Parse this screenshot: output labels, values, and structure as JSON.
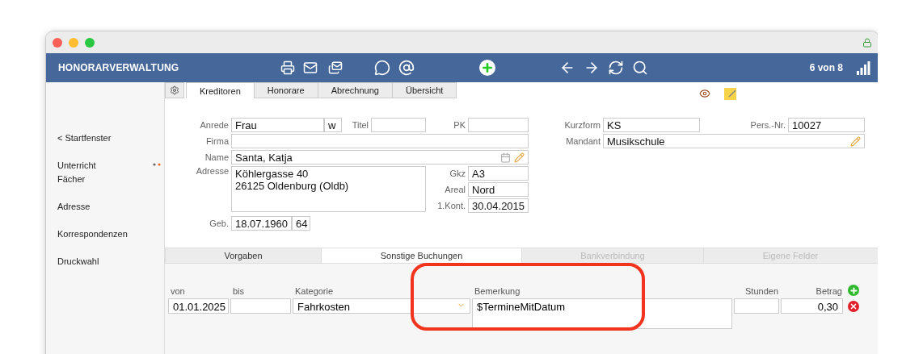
{
  "header": {
    "title": "HONORARVERWALTUNG",
    "counter": "6 von 8"
  },
  "sidebar": {
    "items": [
      {
        "label": "< Startfenster",
        "dots": false
      },
      {
        "label": "Unterricht",
        "dots": true
      },
      {
        "label": "Fächer",
        "dots": false
      },
      {
        "label": "Adresse",
        "dots": false
      },
      {
        "label": "Korrespondenzen",
        "dots": false
      },
      {
        "label": "Druckwahl",
        "dots": false
      }
    ]
  },
  "tabs": [
    {
      "label": "Kreditoren",
      "selected": true
    },
    {
      "label": "Honorare",
      "selected": false
    },
    {
      "label": "Abrechnung",
      "selected": false
    },
    {
      "label": "Übersicht",
      "selected": false
    }
  ],
  "form": {
    "anrede": {
      "label": "Anrede",
      "value": "Frau",
      "gender": "w"
    },
    "titel": {
      "label": "Titel"
    },
    "pk": {
      "label": "PK"
    },
    "firma": {
      "label": "Firma"
    },
    "name": {
      "label": "Name",
      "value": "Santa, Katja"
    },
    "adresse": {
      "label": "Adresse",
      "lines": [
        "Köhlergasse 40",
        "26125 Oldenburg (Oldb)"
      ]
    },
    "gkz": {
      "label": "Gkz",
      "value": "A3"
    },
    "areal": {
      "label": "Areal",
      "value": "Nord"
    },
    "kont": {
      "label": "1.Kont.",
      "value": "30.04.2015"
    },
    "geb": {
      "label": "Geb.",
      "value": "18.07.1960",
      "age": "64"
    },
    "kurzform": {
      "label": "Kurzform",
      "value": "KS"
    },
    "persnr": {
      "label": "Pers.-Nr.",
      "value": "10027"
    },
    "mandant": {
      "label": "Mandant",
      "value": "Musikschule"
    }
  },
  "subtabs": [
    {
      "label": "Vorgaben",
      "selected": false,
      "disabled": false
    },
    {
      "label": "Sonstige Buchungen",
      "selected": true,
      "disabled": false
    },
    {
      "label": "Bankverbindung",
      "selected": false,
      "disabled": true
    },
    {
      "label": "Eigene Felder",
      "selected": false,
      "disabled": true
    }
  ],
  "bookings": {
    "columns": [
      "von",
      "bis",
      "Kategorie",
      "Bemerkung",
      "Stunden",
      "Betrag"
    ],
    "rows": [
      {
        "von": "01.01.2025",
        "kategorie": "Fahrkosten",
        "bemerkung": "$TermineMitDatum",
        "betrag": "0,30"
      }
    ]
  }
}
